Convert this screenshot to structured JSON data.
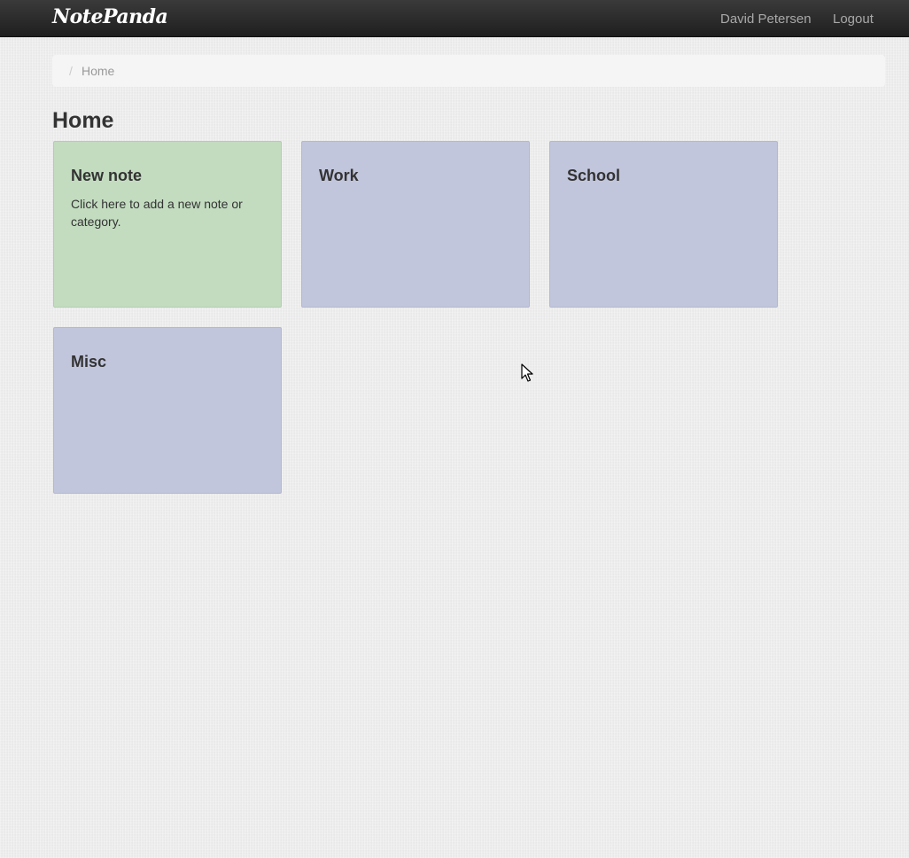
{
  "navbar": {
    "brand": "NotePanda",
    "user_name": "David Petersen",
    "logout_label": "Logout"
  },
  "breadcrumb": {
    "divider": "/",
    "current": "Home"
  },
  "page": {
    "title": "Home"
  },
  "tiles": [
    {
      "title": "New note",
      "description": "Click here to add a new note or category.",
      "color": "#c3dcc0"
    },
    {
      "title": "Work",
      "description": "",
      "color": "#c2c6dc"
    },
    {
      "title": "School",
      "description": "",
      "color": "#c2c6dc"
    },
    {
      "title": "Misc",
      "description": "",
      "color": "#c2c6dc"
    }
  ],
  "colors": {
    "navbar": "#222222",
    "new_note_tile": "#c3dcc0",
    "category_tile": "#c2c6dc"
  }
}
